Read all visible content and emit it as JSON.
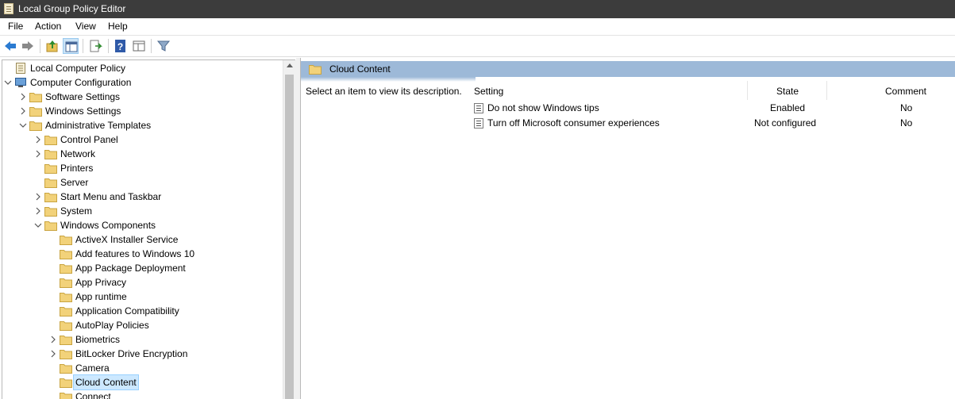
{
  "window": {
    "title": "Local Group Policy Editor",
    "icon": "policy-doc-icon"
  },
  "menu": {
    "items": [
      "File",
      "Action",
      "View",
      "Help"
    ]
  },
  "toolbar": {
    "buttons": [
      {
        "name": "back-icon"
      },
      {
        "name": "forward-icon"
      },
      {
        "name": "up-folder-icon"
      },
      {
        "name": "show-hide-console-tree-icon"
      },
      {
        "name": "export-list-icon"
      },
      {
        "name": "help-icon"
      },
      {
        "name": "extended-view-icon"
      },
      {
        "name": "filter-icon"
      }
    ]
  },
  "tree": {
    "items": [
      {
        "label": "Local Computer Policy",
        "level": 0,
        "expander": "none",
        "icon": "policy-doc-icon"
      },
      {
        "label": "Computer Configuration",
        "level": 0,
        "expander": "expanded",
        "icon": "computer-icon"
      },
      {
        "label": "Software Settings",
        "level": 1,
        "expander": "collapsed",
        "icon": "folder-icon"
      },
      {
        "label": "Windows Settings",
        "level": 1,
        "expander": "collapsed",
        "icon": "folder-icon"
      },
      {
        "label": "Administrative Templates",
        "level": 1,
        "expander": "expanded",
        "icon": "folder-icon"
      },
      {
        "label": "Control Panel",
        "level": 2,
        "expander": "collapsed",
        "icon": "folder-icon"
      },
      {
        "label": "Network",
        "level": 2,
        "expander": "collapsed",
        "icon": "folder-icon"
      },
      {
        "label": "Printers",
        "level": 2,
        "expander": "none",
        "icon": "folder-icon"
      },
      {
        "label": "Server",
        "level": 2,
        "expander": "none",
        "icon": "folder-icon"
      },
      {
        "label": "Start Menu and Taskbar",
        "level": 2,
        "expander": "collapsed",
        "icon": "folder-icon"
      },
      {
        "label": "System",
        "level": 2,
        "expander": "collapsed",
        "icon": "folder-icon"
      },
      {
        "label": "Windows Components",
        "level": 2,
        "expander": "expanded",
        "icon": "folder-icon"
      },
      {
        "label": "ActiveX Installer Service",
        "level": 3,
        "expander": "none",
        "icon": "folder-icon"
      },
      {
        "label": "Add features to Windows 10",
        "level": 3,
        "expander": "none",
        "icon": "folder-icon"
      },
      {
        "label": "App Package Deployment",
        "level": 3,
        "expander": "none",
        "icon": "folder-icon"
      },
      {
        "label": "App Privacy",
        "level": 3,
        "expander": "none",
        "icon": "folder-icon"
      },
      {
        "label": "App runtime",
        "level": 3,
        "expander": "none",
        "icon": "folder-icon"
      },
      {
        "label": "Application Compatibility",
        "level": 3,
        "expander": "none",
        "icon": "folder-icon"
      },
      {
        "label": "AutoPlay Policies",
        "level": 3,
        "expander": "none",
        "icon": "folder-icon"
      },
      {
        "label": "Biometrics",
        "level": 3,
        "expander": "collapsed",
        "icon": "folder-icon"
      },
      {
        "label": "BitLocker Drive Encryption",
        "level": 3,
        "expander": "collapsed",
        "icon": "folder-icon"
      },
      {
        "label": "Camera",
        "level": 3,
        "expander": "none",
        "icon": "folder-icon"
      },
      {
        "label": "Cloud Content",
        "level": 3,
        "expander": "none",
        "icon": "folder-icon",
        "selected": true
      },
      {
        "label": "Connect",
        "level": 3,
        "expander": "none",
        "icon": "folder-icon"
      }
    ]
  },
  "details": {
    "header_title": "Cloud Content",
    "description": "Select an item to view its description.",
    "columns": {
      "setting": "Setting",
      "state": "State",
      "comment": "Comment"
    },
    "rows": [
      {
        "setting": "Do not show Windows tips",
        "state": "Enabled",
        "comment": "No"
      },
      {
        "setting": "Turn off Microsoft consumer experiences",
        "state": "Not configured",
        "comment": "No"
      }
    ]
  },
  "colors": {
    "titlebar": "#3c3c3c",
    "header_band": "#9db9d8",
    "selection": "#cce8ff",
    "folder": "#f2d27a"
  }
}
